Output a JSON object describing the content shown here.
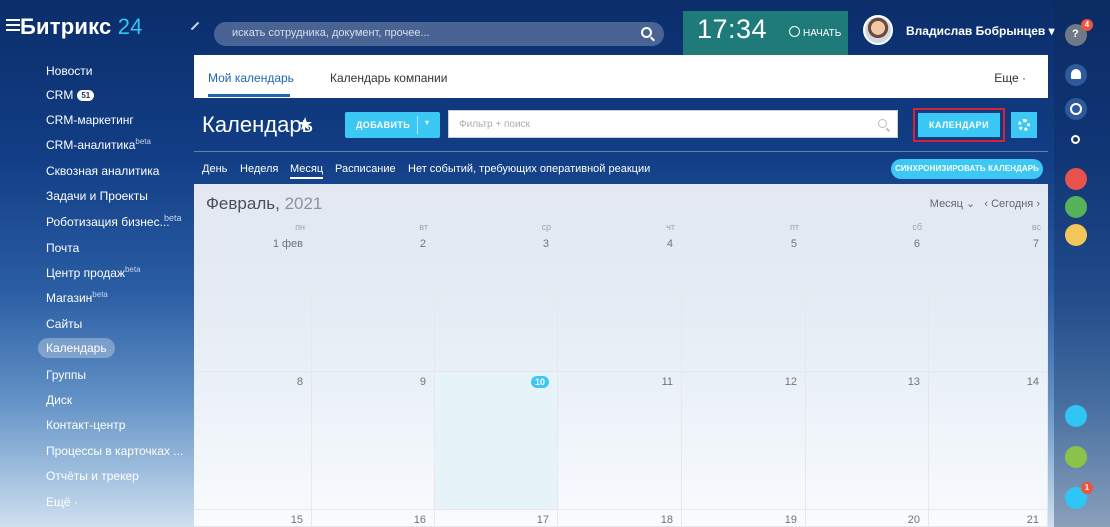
{
  "app": {
    "logo_text": "Битрикс",
    "logo_num": "24",
    "search_placeholder": "искать сотрудника, документ, прочее...",
    "clock": "17:34",
    "start_label": "НАЧАТЬ",
    "user_name": "Владислав Бобрынцев",
    "user_caret": "▾",
    "help_badge": "4",
    "rail_badge_bottom": "1"
  },
  "sidebar": {
    "items": [
      {
        "label": "Новости"
      },
      {
        "label": "CRM",
        "count": "51"
      },
      {
        "label": "CRM-маркетинг"
      },
      {
        "label": "CRM-аналитика",
        "sup": "beta"
      },
      {
        "label": "Сквозная аналитика"
      },
      {
        "label": "Задачи и Проекты"
      },
      {
        "label": "Роботизация бизнес...",
        "beta": "beta"
      },
      {
        "label": "Почта"
      },
      {
        "label": "Центр продаж",
        "sup": "beta"
      },
      {
        "label": "Магазин",
        "sup": "beta"
      },
      {
        "label": "Сайты"
      },
      {
        "label": "Календарь"
      },
      {
        "label": "Группы"
      },
      {
        "label": "Диск"
      },
      {
        "label": "Контакт-центр"
      },
      {
        "label": "Процессы в карточках ..."
      },
      {
        "label": "Отчёты и трекер"
      },
      {
        "label": "Ещё ·"
      }
    ]
  },
  "tabs": {
    "my_calendar": "Мой календарь",
    "company_calendar": "Календарь компании",
    "more": "Еще ·"
  },
  "toolbar": {
    "title": "Календарь",
    "star": "★",
    "add_label": "ДОБАВИТЬ",
    "add_caret": "▾",
    "filter_placeholder": "Фильтр + поиск",
    "calendars_label": "КАЛЕНДАРИ"
  },
  "views": {
    "day": "День",
    "week": "Неделя",
    "month": "Месяц",
    "schedule": "Расписание",
    "no_events": "Нет событий, требующих оперативной реакции",
    "sync_label": "СИНХРОНИЗИРОВАТЬ КАЛЕНДАРЬ"
  },
  "grid": {
    "month_name": "Февраль,",
    "year": "2021",
    "mode_label": "Месяц ⌄",
    "today_label": "‹ Сегодня ›",
    "weekdays": [
      "пн",
      "вт",
      "ср",
      "чт",
      "пт",
      "сб",
      "вс"
    ],
    "weeks": [
      [
        "1 фев",
        "2",
        "3",
        "4",
        "5",
        "6",
        "7"
      ],
      [
        "8",
        "9",
        "10",
        "11",
        "12",
        "13",
        "14"
      ],
      [
        "15",
        "16",
        "17",
        "18",
        "19",
        "20",
        "21"
      ]
    ],
    "today": "10"
  }
}
